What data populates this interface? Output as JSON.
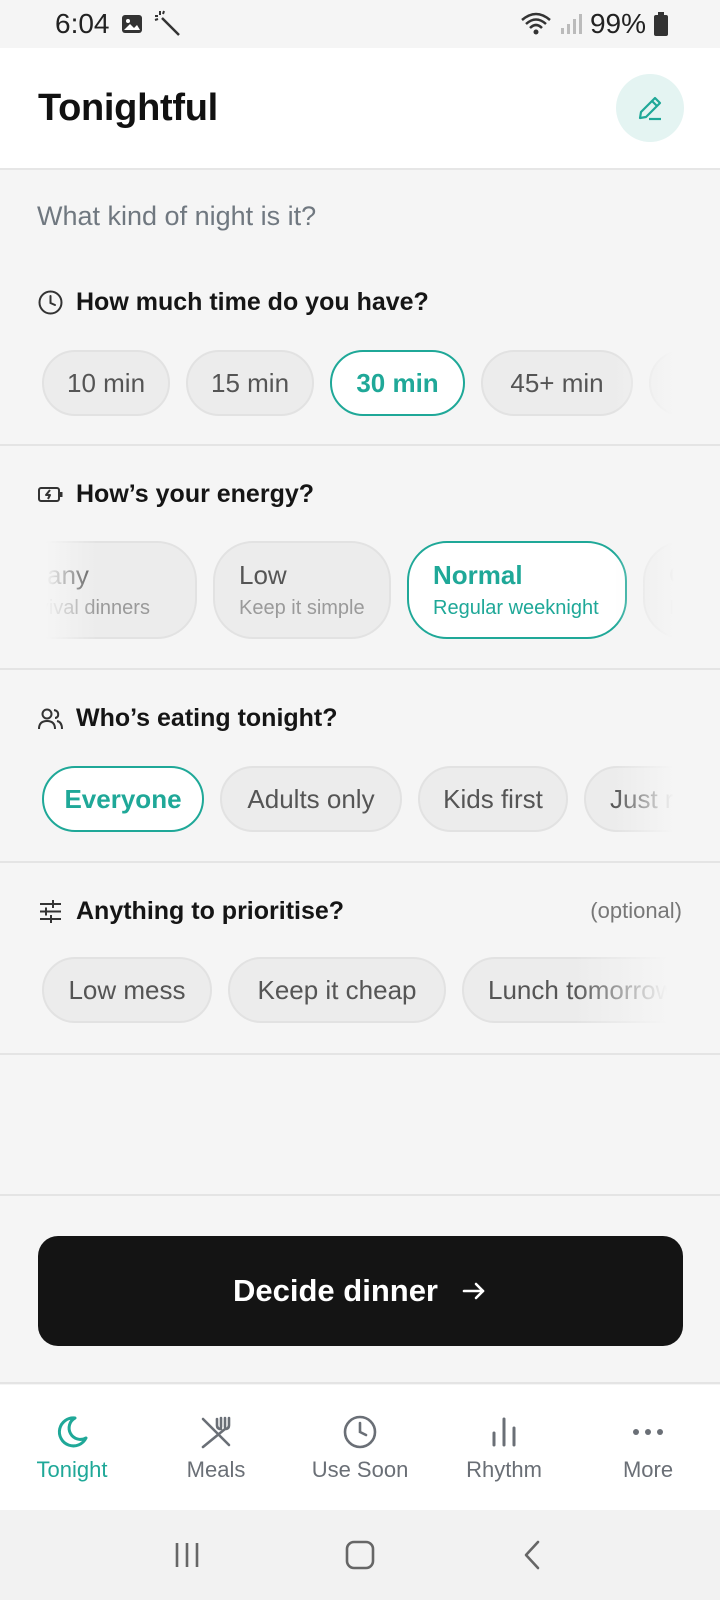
{
  "status_bar": {
    "time": "6:04",
    "battery": "99%"
  },
  "header": {
    "title": "Tonightful"
  },
  "prompt": "What kind of night is it?",
  "sections": {
    "time": {
      "title": "How much time do you have?",
      "options": [
        "10 min",
        "15 min",
        "30 min",
        "45+ min"
      ],
      "selected": "30 min"
    },
    "energy": {
      "title": "How’s your energy?",
      "options": [
        {
          "label": "ly any",
          "sub": "urvival dinners"
        },
        {
          "label": "Low",
          "sub": "Keep it simple"
        },
        {
          "label": "Normal",
          "sub": "Regular weeknight"
        },
        {
          "label": "G",
          "sub": "I"
        }
      ],
      "selected": "Normal"
    },
    "eaters": {
      "title": "Who’s eating tonight?",
      "options": [
        "Everyone",
        "Adults only",
        "Kids first",
        "Just r"
      ],
      "selected": "Everyone"
    },
    "priorities": {
      "title": "Anything to prioritise?",
      "optional_label": "(optional)",
      "options": [
        "Low mess",
        "Keep it cheap",
        "Lunch tomorrow"
      ]
    }
  },
  "cta": {
    "label": "Decide dinner"
  },
  "bottom_nav": [
    {
      "label": "Tonight",
      "icon": "moon-icon",
      "active": true
    },
    {
      "label": "Meals",
      "icon": "fork-knife-icon",
      "active": false
    },
    {
      "label": "Use Soon",
      "icon": "clock-icon",
      "active": false
    },
    {
      "label": "Rhythm",
      "icon": "bar-chart-icon",
      "active": false
    },
    {
      "label": "More",
      "icon": "more-dots-icon",
      "active": false
    }
  ],
  "colors": {
    "accent": "#1fa898",
    "cta_bg": "#141414",
    "background": "#f5f5f5"
  }
}
